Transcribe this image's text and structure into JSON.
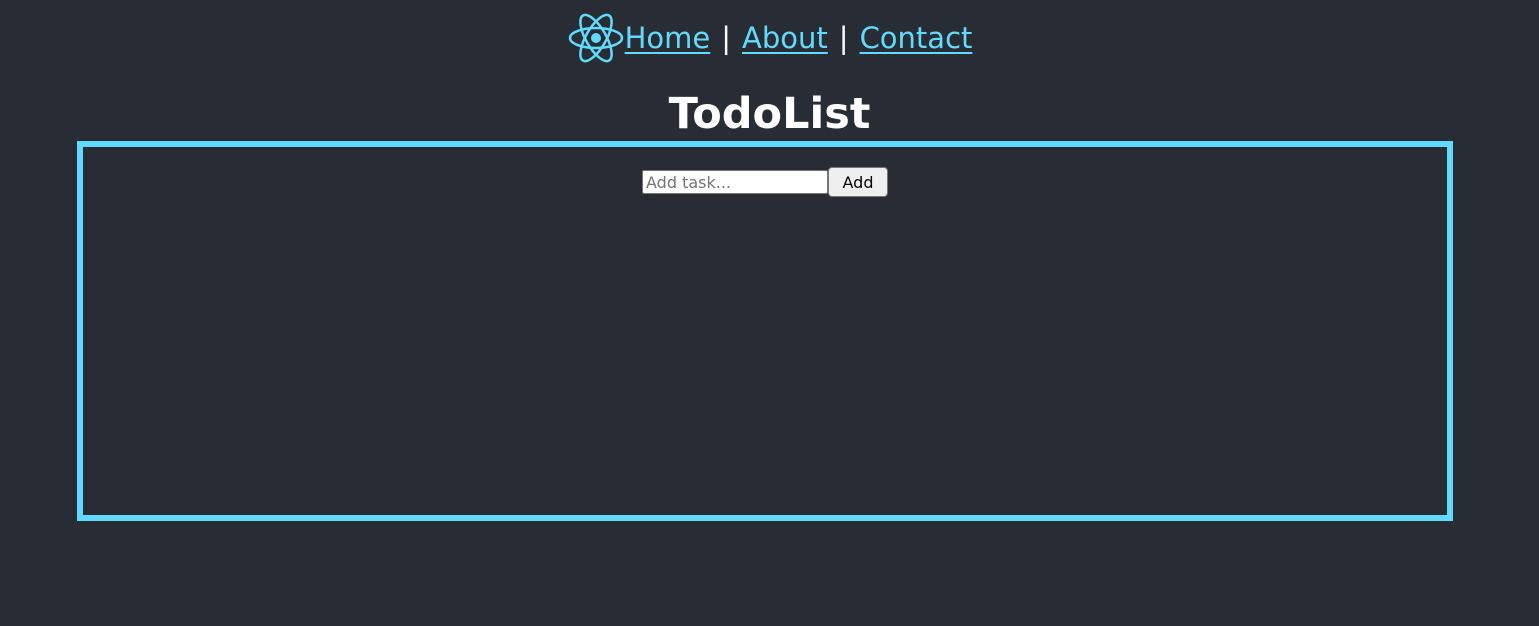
{
  "nav": {
    "links": [
      {
        "label": "Home"
      },
      {
        "label": "About"
      },
      {
        "label": "Contact"
      }
    ],
    "separator": "|",
    "logo_icon": "react-atom-icon"
  },
  "page": {
    "title": "TodoList"
  },
  "todo": {
    "input_placeholder": "Add task...",
    "input_value": "",
    "add_button_label": "Add",
    "items": []
  },
  "colors": {
    "background": "#282c34",
    "accent": "#61dafb",
    "text": "#ffffff"
  }
}
